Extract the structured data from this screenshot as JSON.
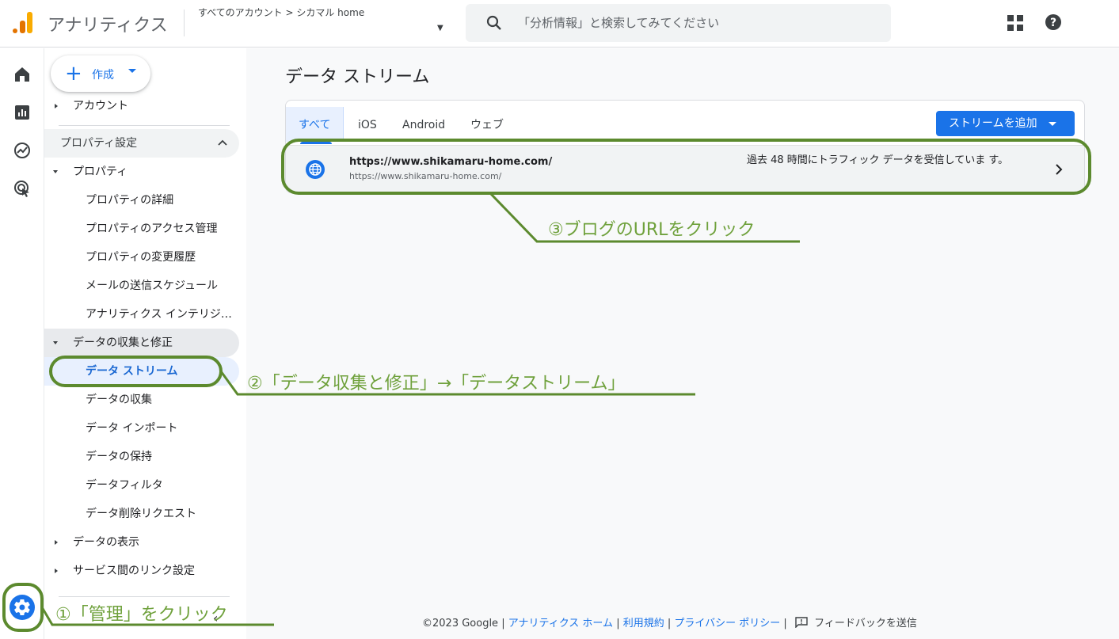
{
  "header": {
    "app_title": "アナリティクス",
    "breadcrumb": "すべてのアカウント > シカマル home",
    "search_placeholder": "「分析情報」と検索してみてください",
    "apps_icon": "apps-grid-icon",
    "help_icon": "help-icon"
  },
  "rail": {
    "items": [
      "home-icon",
      "reports-icon",
      "explore-icon",
      "advertising-icon"
    ],
    "admin": "admin-gear-icon"
  },
  "nav": {
    "create_label": "作成",
    "account": "アカウント",
    "section_title": "プロパティ設定",
    "property": "プロパティ",
    "property_items": [
      "プロパティの詳細",
      "プロパティのアクセス管理",
      "プロパティの変更履歴",
      "メールの送信スケジュール",
      "アナリティクス インテリジ…"
    ],
    "data_collection": "データの収集と修正",
    "data_items": [
      "データ ストリーム",
      "データの収集",
      "データ インポート",
      "データの保持",
      "データフィルタ",
      "データ削除リクエスト"
    ],
    "data_display": "データの表示",
    "service_links": "サービス間のリンク設定"
  },
  "main": {
    "title": "データ ストリーム",
    "tabs": [
      "すべて",
      "iOS",
      "Android",
      "ウェブ"
    ],
    "active_tab": "すべて",
    "add_stream_label": "ストリームを追加",
    "stream": {
      "name": "https://www.shikamaru-home.com/",
      "url": "https://www.shikamaru-home.com/",
      "status": "過去 48 時間にトラフィック データを受信していま す。"
    }
  },
  "footer": {
    "copyright": "©2023 Google",
    "sep": "|",
    "links": [
      "アナリティクス ホーム",
      "利用規約",
      "プライバシー ポリシー"
    ],
    "feedback": "フィードバックを送信"
  },
  "annotations": {
    "step1": "①「管理」をクリック",
    "step2": "②「データ収集と修正」→「データストリーム」",
    "step3": "③ブログのURLをクリック",
    "color": "#6fa13c"
  },
  "colors": {
    "accent": "#1a73e8",
    "logo_dark": "#e37400",
    "logo_light": "#f9ab00"
  }
}
